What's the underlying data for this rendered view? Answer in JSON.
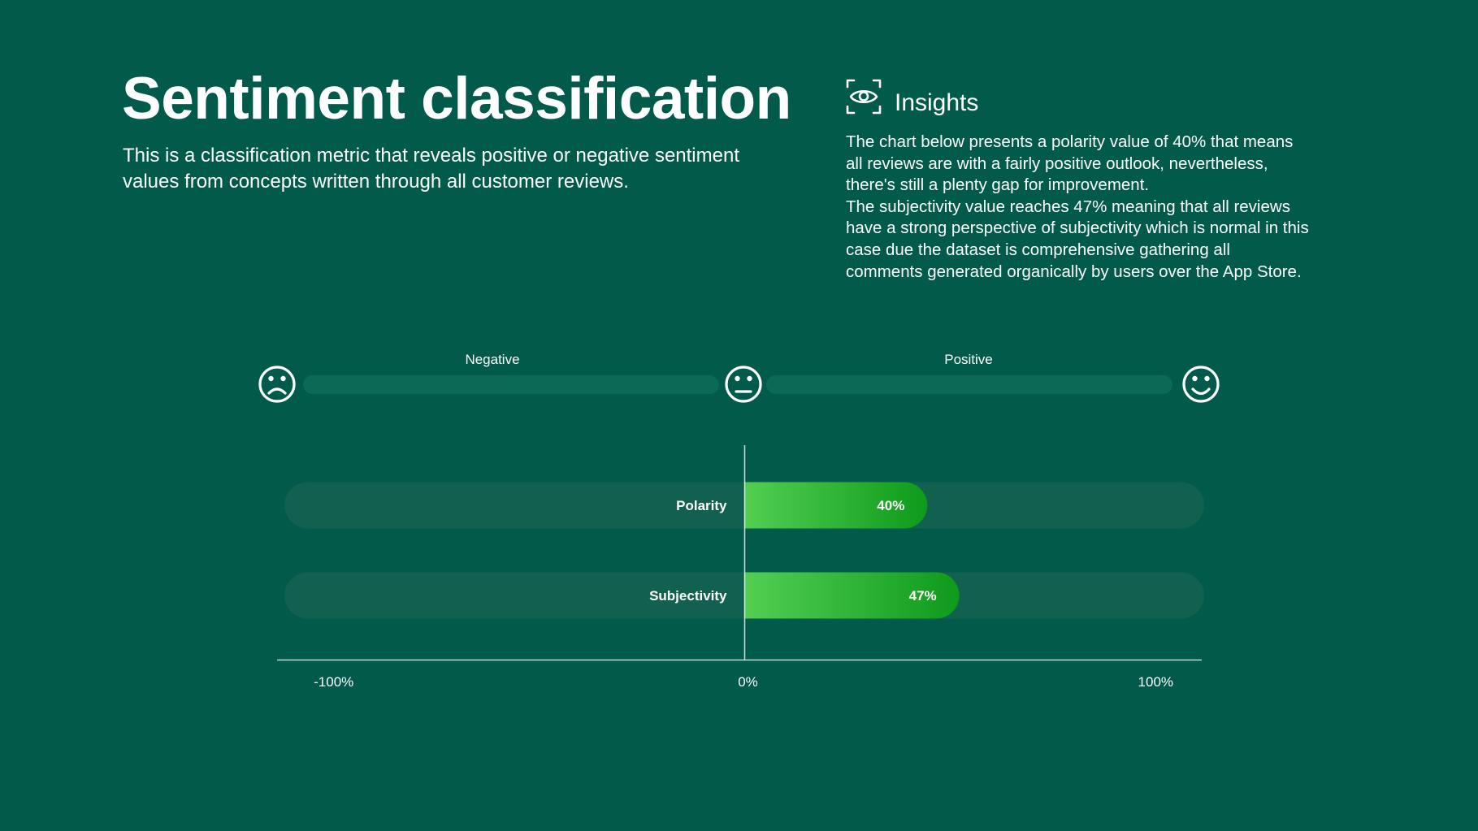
{
  "header": {
    "title": "Sentiment classification",
    "subtitle": "This is a classification metric that reveals positive or negative sentiment values from concepts written through all customer reviews."
  },
  "insights": {
    "icon": "eye-icon",
    "title": "Insights",
    "paragraphs": [
      "The chart below presents a polarity value of 40% that means all reviews are with a fairly positive outlook, nevertheless, there's still a plenty gap for improvement.",
      "The subjectivity value reaches 47% meaning that all reviews have a strong perspective of subjectivity which is normal in this case due the dataset is comprehensive gathering all comments generated organically by users over the App Store."
    ]
  },
  "scale": {
    "negative_label": "Negative",
    "positive_label": "Positive",
    "icons": [
      "sad-face-icon",
      "neutral-face-icon",
      "happy-face-icon"
    ]
  },
  "colors": {
    "background": "#025B4A",
    "track": "#12604F",
    "scale_bar": "#0B6A55",
    "bar_start": "#52CF52",
    "bar_end": "#0E9A1B"
  },
  "chart_data": {
    "type": "bar",
    "orientation": "horizontal",
    "categories": [
      "Polarity",
      "Subjectivity"
    ],
    "values": [
      40,
      47
    ],
    "value_labels": [
      "40%",
      "47%"
    ],
    "xlim": [
      -100,
      100
    ],
    "xticks": [
      -100,
      0,
      100
    ],
    "xtick_labels": [
      "-100%",
      "0%",
      "100%"
    ],
    "grid": false
  }
}
